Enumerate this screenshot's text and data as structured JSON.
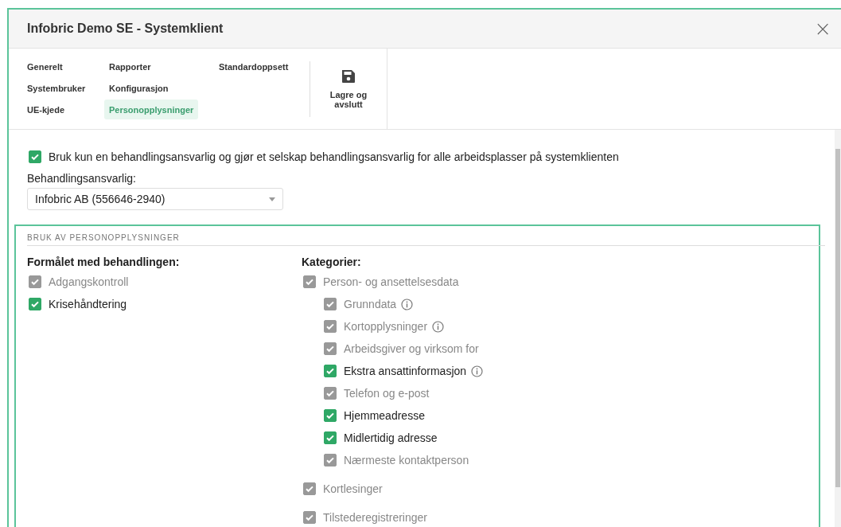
{
  "window": {
    "title": "Infobric Demo SE - Systemklient",
    "close": "×"
  },
  "tabs": [
    {
      "label": "Generelt",
      "selected": false
    },
    {
      "label": "Systembruker",
      "selected": false
    },
    {
      "label": "UE-kjede",
      "selected": false
    },
    {
      "label": "Rapporter",
      "selected": false
    },
    {
      "label": "Konfigurasjon",
      "selected": false
    },
    {
      "label": "Personopplysninger",
      "selected": true
    },
    {
      "label": "Standardoppsett",
      "selected": false
    }
  ],
  "save_button": {
    "label": "Lagre og avslutt"
  },
  "single_controller": {
    "label": "Bruk kun en behandlingsansvarlig og gjør et selskap behandlingsansvarlig for alle arbeidsplasser på systemklienten",
    "checked": true,
    "disabled": false
  },
  "controller_select": {
    "label": "Behandlingsansvarlig:",
    "value": "Infobric AB (556646-2940)"
  },
  "section": {
    "title": "BRUK AV PERSONOPPLYSNINGER",
    "purposes": {
      "heading": "Formålet med behandlingen:",
      "items": [
        {
          "label": "Adgangskontroll",
          "checked": true,
          "disabled": true
        },
        {
          "label": "Krisehåndtering",
          "checked": true,
          "disabled": false
        }
      ]
    },
    "categories": {
      "heading": "Kategorier:",
      "items": [
        {
          "label": "Person- og ansettelsesdata",
          "checked": true,
          "disabled": true,
          "info": false,
          "children": [
            {
              "label": "Grunndata",
              "checked": true,
              "disabled": true,
              "info": true
            },
            {
              "label": "Kortopplysninger",
              "checked": true,
              "disabled": true,
              "info": true
            },
            {
              "label": "Arbeidsgiver og virksom for",
              "checked": true,
              "disabled": true,
              "info": false
            },
            {
              "label": "Ekstra ansattinformasjon",
              "checked": true,
              "disabled": false,
              "info": true
            },
            {
              "label": "Telefon og e-post",
              "checked": true,
              "disabled": true,
              "info": false
            },
            {
              "label": "Hjemmeadresse",
              "checked": true,
              "disabled": false,
              "info": false
            },
            {
              "label": "Midlertidig adresse",
              "checked": true,
              "disabled": false,
              "info": false
            },
            {
              "label": "Nærmeste kontaktperson",
              "checked": true,
              "disabled": true,
              "info": false
            }
          ]
        },
        {
          "label": "Kortlesinger",
          "checked": true,
          "disabled": true,
          "info": false
        },
        {
          "label": "Tilstederegistreringer",
          "checked": true,
          "disabled": true,
          "info": false
        }
      ]
    }
  }
}
